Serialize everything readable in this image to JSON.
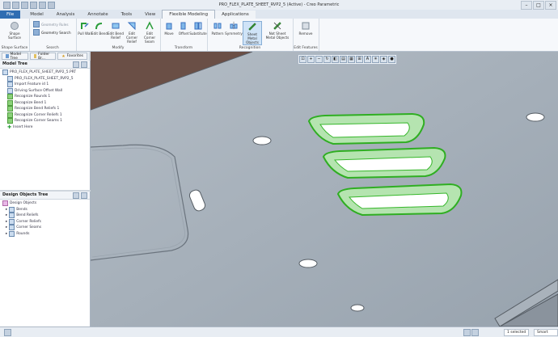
{
  "window": {
    "title": "PRO_FLEX_PLATE_SHEET_RVP2_5 (Active) - Creo Parametric"
  },
  "tabs": [
    {
      "label": "File"
    },
    {
      "label": "Model"
    },
    {
      "label": "Analysis"
    },
    {
      "label": "Annotate"
    },
    {
      "label": "Tools"
    },
    {
      "label": "View"
    },
    {
      "label": "Flexible Modeling"
    },
    {
      "label": "Applications"
    }
  ],
  "ribbon": {
    "shape_surface": {
      "label": "Shape Surface",
      "button": "Shape Surface"
    },
    "search": {
      "label": "Search",
      "geometry_rules": "Geometry Rules",
      "geometry_search": "Geometry Search"
    },
    "modify": {
      "label": "Modify",
      "buttons": [
        "Pull Wall",
        "Edit Bend",
        "Edit Bend Relief",
        "Edit Corner Relief",
        "Edit Corner Seam"
      ]
    },
    "transform": {
      "label": "Transform",
      "buttons": [
        "Move",
        "Offset",
        "Substitute"
      ]
    },
    "recognition": {
      "label": "Recognition",
      "buttons": [
        "Pattern",
        "Symmetry",
        "Sheet Metal Objects",
        "Not Sheet Metal Objects"
      ]
    },
    "edit_features": {
      "label": "Edit Features",
      "buttons": [
        "Remove"
      ]
    }
  },
  "left_tabs": [
    {
      "label": "Model Tree"
    },
    {
      "label": "Folder Br..."
    },
    {
      "label": "Favorites"
    }
  ],
  "model_tree": {
    "title": "Model Tree",
    "root": "PRO_FLEX_PLATE_SHEET_RVP2_5.PRT",
    "items": [
      "PRO_FLEX_PLATE_SHEET_RVP2_5",
      "Import Feature id 1",
      "Driving Surface Offset Wall",
      "Recognize Rounds 1",
      "Recognize Bend 1",
      "Recognize Bend Reliefs 1",
      "Recognize Corner Reliefs 1",
      "Recognize Corner Seams 1",
      "Insert Here"
    ]
  },
  "design_objects": {
    "title": "Design Objects Tree",
    "root": "Design Objects",
    "items": [
      "Bends",
      "Bend Reliefs",
      "Corner Reliefs",
      "Corner Seams",
      "Rounds"
    ]
  },
  "status": {
    "selected": "1 selected",
    "filter": "Smart"
  },
  "colors": {
    "accent": "#2f6db2",
    "sheet": "#a7b1bb",
    "feature_green": "#2fae22"
  }
}
